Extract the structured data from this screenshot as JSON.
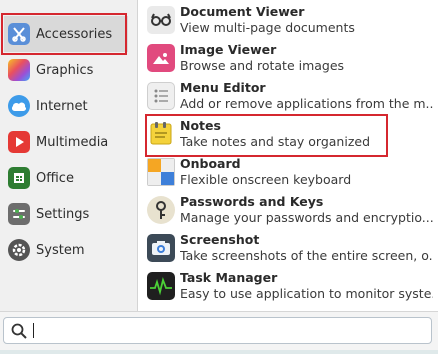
{
  "categories": [
    {
      "id": "accessories",
      "label": "Accessories",
      "icon": "accessories-icon",
      "color": "#5a8fd8"
    },
    {
      "id": "graphics",
      "label": "Graphics",
      "icon": "graphics-icon",
      "color": "#e05aa0"
    },
    {
      "id": "internet",
      "label": "Internet",
      "icon": "internet-icon",
      "color": "#4aa3e8"
    },
    {
      "id": "multimedia",
      "label": "Multimedia",
      "icon": "multimedia-icon",
      "color": "#e53935"
    },
    {
      "id": "office",
      "label": "Office",
      "icon": "office-icon",
      "color": "#2e7d32"
    },
    {
      "id": "settings",
      "label": "Settings",
      "icon": "settings-icon",
      "color": "#6d6d6d"
    },
    {
      "id": "system",
      "label": "System",
      "icon": "system-icon",
      "color": "#555555"
    }
  ],
  "selected_category": "Accessories",
  "apps": [
    {
      "name": "Document Viewer",
      "desc": "View multi-page documents",
      "icon": "document-viewer-icon"
    },
    {
      "name": "Image Viewer",
      "desc": "Browse and rotate images",
      "icon": "image-viewer-icon"
    },
    {
      "name": "Menu Editor",
      "desc": "Add or remove applications from the m...",
      "icon": "menu-editor-icon"
    },
    {
      "name": "Notes",
      "desc": "Take notes and stay organized",
      "icon": "notes-icon"
    },
    {
      "name": "Onboard",
      "desc": "Flexible onscreen keyboard",
      "icon": "onboard-icon"
    },
    {
      "name": "Passwords and Keys",
      "desc": "Manage your passwords and encryptio...",
      "icon": "passwords-icon"
    },
    {
      "name": "Screenshot",
      "desc": "Take screenshots of the entire screen, o...",
      "icon": "screenshot-icon"
    },
    {
      "name": "Task Manager",
      "desc": "Easy to use application to monitor syste...",
      "icon": "task-manager-icon"
    }
  ],
  "search": {
    "value": "",
    "icon": "search-icon"
  },
  "colors": {
    "highlight": "#d5272f",
    "accent": "#5a8fd8"
  }
}
